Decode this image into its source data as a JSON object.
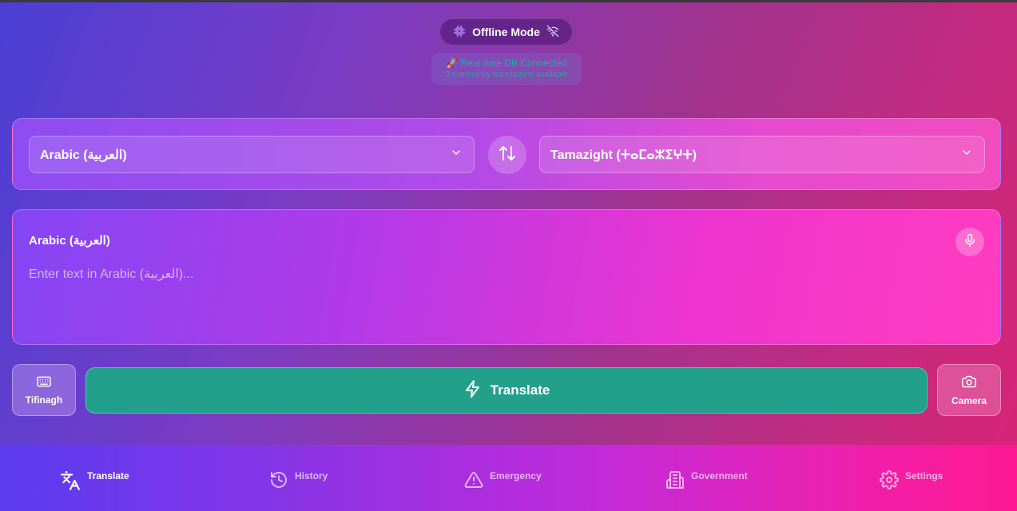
{
  "status": {
    "offline_label": "Offline Mode",
    "db_title": "🚀 Real-time DB Connected",
    "db_subtitle": "3 community translations available"
  },
  "languages": {
    "source": "Arabic (العربية)",
    "target": "Tamazight (ⵜⴰⵎⴰⵣⵉⵖⵜ)"
  },
  "input": {
    "label": "Arabic (العربية)",
    "value": "",
    "placeholder": "Enter text in Arabic (العربية)..."
  },
  "actions": {
    "tifinagh_label": "Tifinagh",
    "translate_label": "Translate",
    "camera_label": "Camera"
  },
  "nav": [
    {
      "label": "Translate",
      "icon": "translate-icon",
      "active": true
    },
    {
      "label": "History",
      "icon": "history-icon",
      "active": false
    },
    {
      "label": "Emergency",
      "icon": "warning-icon",
      "active": false
    },
    {
      "label": "Government",
      "icon": "building-icon",
      "active": false
    },
    {
      "label": "Settings",
      "icon": "gear-icon",
      "active": false
    }
  ],
  "colors": {
    "accent_teal": "#22a08b",
    "status_text": "#19b39a"
  }
}
